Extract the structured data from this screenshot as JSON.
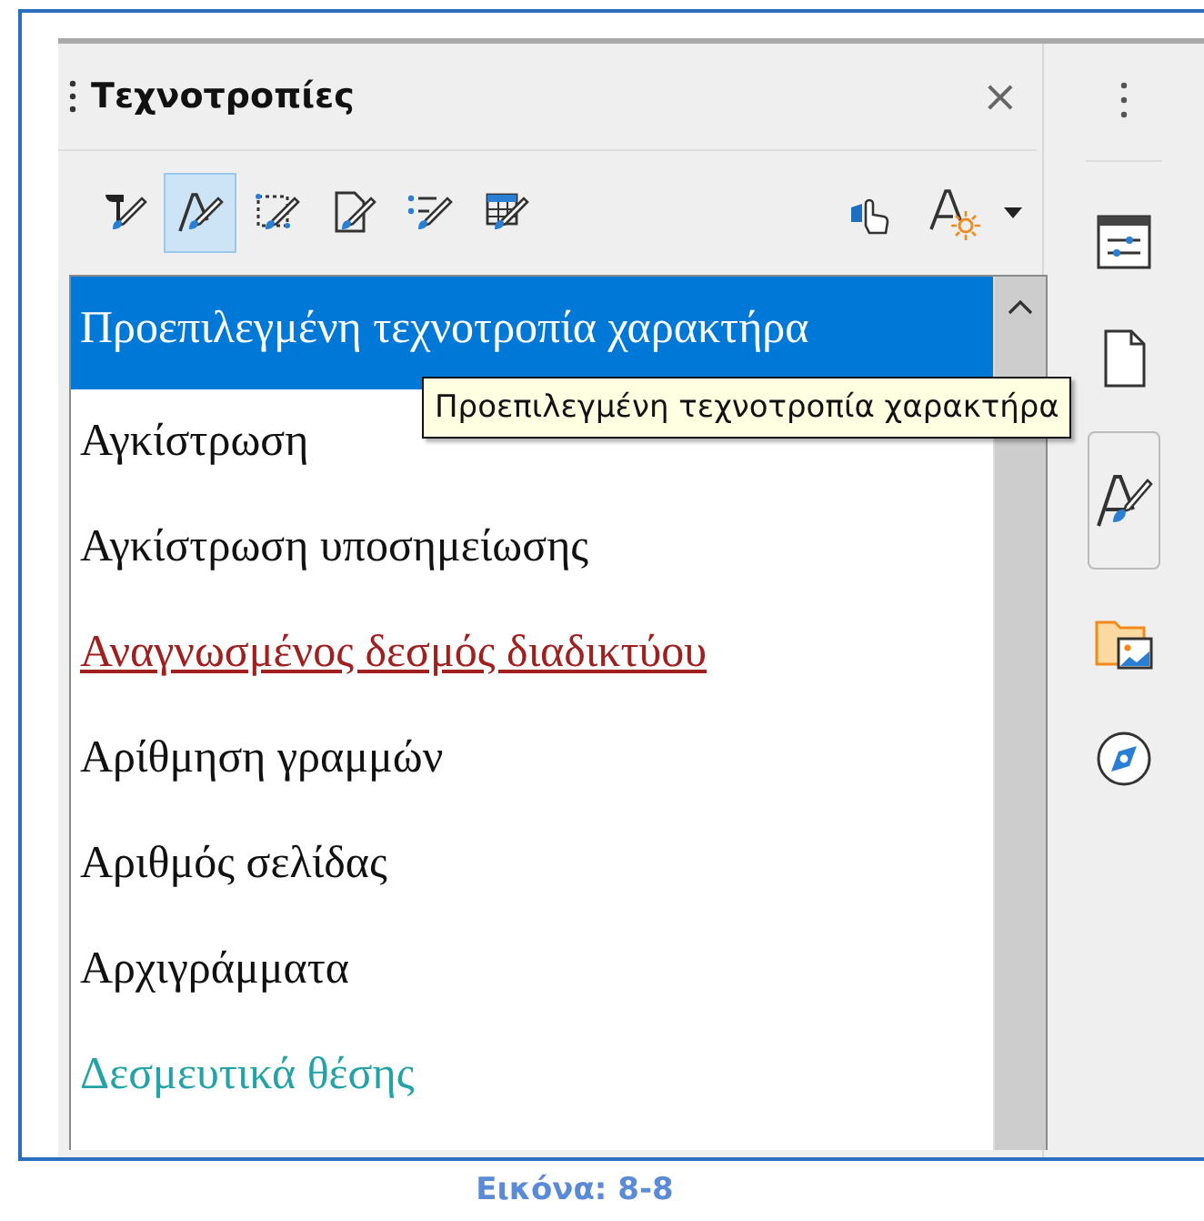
{
  "panel": {
    "title": "Τεχνοτροπίες",
    "close": "×"
  },
  "toolbar": {
    "families": [
      {
        "selected": false
      },
      {
        "selected": true
      },
      {
        "selected": false
      },
      {
        "selected": false
      },
      {
        "selected": false
      },
      {
        "selected": false
      }
    ]
  },
  "styles": [
    {
      "label": "Προεπιλεγμένη τεχνοτροπία χαρακτήρα",
      "selected": true,
      "kind": "plain"
    },
    {
      "label": "Αγκίστρωση",
      "selected": false,
      "kind": "plain"
    },
    {
      "label": "Αγκίστρωση υποσημείωσης",
      "selected": false,
      "kind": "plain"
    },
    {
      "label": "Αναγνωσμένος δεσμός διαδικτύου",
      "selected": false,
      "kind": "visited-link"
    },
    {
      "label": "Αρίθμηση γραμμών",
      "selected": false,
      "kind": "plain"
    },
    {
      "label": "Αριθμός σελίδας",
      "selected": false,
      "kind": "plain"
    },
    {
      "label": "Αρχιγράμματα",
      "selected": false,
      "kind": "plain"
    },
    {
      "label": "Δεσμευτικά θέσης",
      "selected": false,
      "kind": "placeholder"
    }
  ],
  "tooltip": "Προεπιλεγμένη τεχνοτροπία χαρακτήρα",
  "sidebar_tabs": [
    {
      "selected": false
    },
    {
      "selected": false
    },
    {
      "selected": true
    },
    {
      "selected": false
    },
    {
      "selected": false
    }
  ],
  "caption": "Εικόνα: 8-8"
}
